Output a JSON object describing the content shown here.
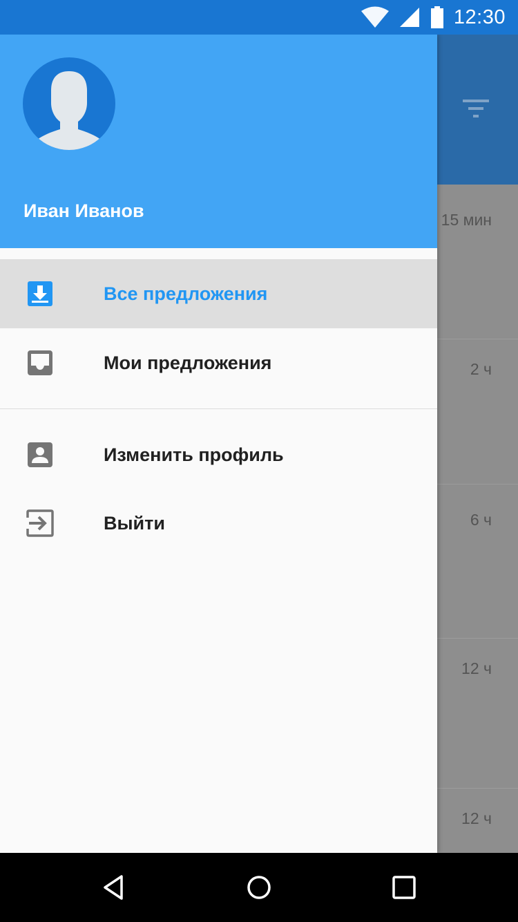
{
  "status_bar": {
    "time": "12:30",
    "icons": [
      "wifi-icon",
      "signal-icon",
      "battery-icon"
    ]
  },
  "background": {
    "appbar_icon": "filter-icon",
    "list_times": [
      "15 мин",
      "2 ч",
      "6 ч",
      "12 ч",
      "12 ч"
    ]
  },
  "drawer": {
    "user_name": "Иван Иванов",
    "avatar_icon": "person-avatar-icon",
    "items": [
      {
        "label": "Все предложения",
        "icon": "inbox-download-icon",
        "active": true
      },
      {
        "label": "Мои предложения",
        "icon": "inbox-icon",
        "active": false
      },
      {
        "label": "Изменить профиль",
        "icon": "account-box-icon",
        "active": false
      },
      {
        "label": "Выйти",
        "icon": "exit-icon",
        "active": false
      }
    ]
  },
  "colors": {
    "status_bar": "#1976d2",
    "header": "#42a5f5",
    "accent": "#2196f3",
    "avatar_bg": "#1976d2",
    "active_item_bg": "#dedede"
  },
  "system_nav": [
    "back-icon",
    "home-icon",
    "recents-icon"
  ]
}
